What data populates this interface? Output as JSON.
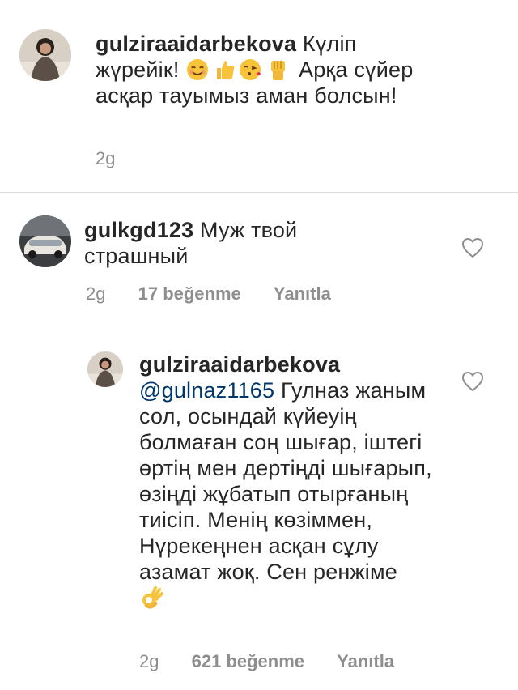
{
  "comments": [
    {
      "username": "gulziraaidarbekova",
      "text_before": "Күліп жүрейік!",
      "emojis": [
        "smiling-face-emoji",
        "thumbs-up-emoji",
        "kissing-face-emoji",
        "raised-fist-emoji"
      ],
      "text_after": "Арқа сүйер асқар тауымыз аман болсын!",
      "time": "2g"
    },
    {
      "username": "gulkgd123",
      "text": "Муж твой страшный",
      "time": "2g",
      "likes": "17 beğenme",
      "reply_label": "Yanıtla"
    },
    {
      "username": "gulziraaidarbekova",
      "mention": "@gulnaz1165",
      "text": "Гулназ жаным сол, осындай күйеуің болмаған соң шығар, іштегі өртің мен дертіңді шығарып, өзіңді жұбатып отырғаның тиісіп. Менің көзіммен, Нүрекеңнен асқан сұлу азамат жоқ. Сен ренжіме",
      "emoji": "ok-hand-emoji",
      "time": "2g",
      "likes": "621 beğenme",
      "reply_label": "Yanıtla"
    }
  ],
  "colors": {
    "text": "#262626",
    "meta": "#8e8e8e",
    "mention": "#00376b",
    "divider": "#dbdbdb"
  }
}
